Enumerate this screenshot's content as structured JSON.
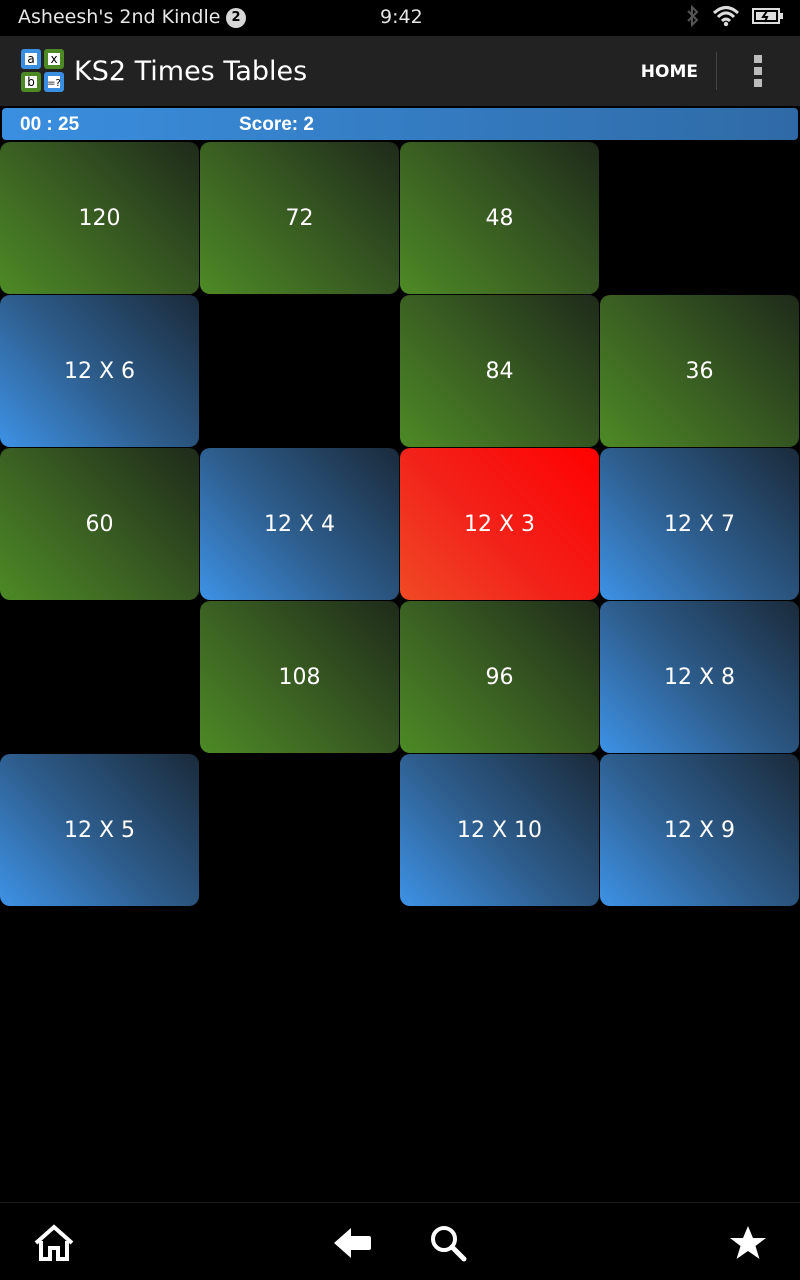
{
  "status_bar": {
    "device_name": "Asheesh's 2nd Kindle",
    "notification_count": "2",
    "time": "9:42"
  },
  "action_bar": {
    "title": "KS2 Times Tables",
    "home_label": "HOME",
    "logo_cells": [
      "a",
      "x",
      "b",
      "=?"
    ]
  },
  "info_bar": {
    "timer": "00 : 25",
    "score": "Score: 2"
  },
  "tiles": [
    {
      "label": "120"
    },
    {
      "label": "72"
    },
    {
      "label": "48"
    },
    {
      "label": "12 X 6"
    },
    {
      "label": "84"
    },
    {
      "label": "36"
    },
    {
      "label": "60"
    },
    {
      "label": "12 X 4"
    },
    {
      "label": "12 X 3"
    },
    {
      "label": "12 X 7"
    },
    {
      "label": "108"
    },
    {
      "label": "96"
    },
    {
      "label": "12 X 8"
    },
    {
      "label": "12 X 5"
    },
    {
      "label": "12 X 10"
    },
    {
      "label": "12 X 9"
    }
  ],
  "colors": {
    "answer_tile": "#3a5f22",
    "question_tile": "#2e5e8e",
    "selected_tile": "#f2221a",
    "info_bar": "#3a8fe0"
  },
  "nav_bar": {
    "icons": [
      "home-icon",
      "back-icon",
      "search-icon",
      "favorites-icon"
    ]
  }
}
